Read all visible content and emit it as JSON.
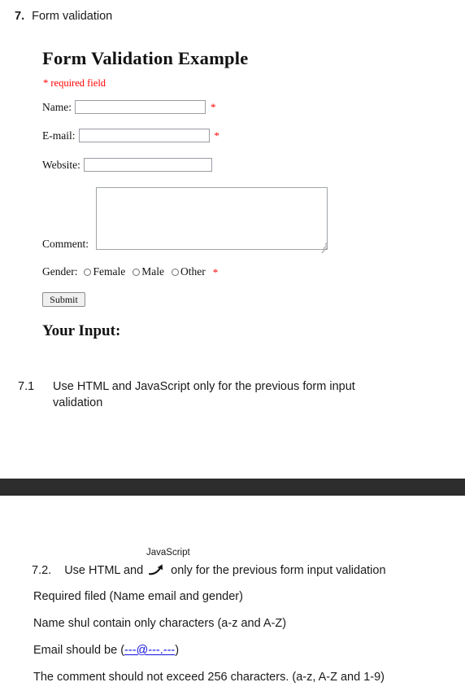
{
  "document": {
    "heading_number": "7.",
    "heading_text": "Form validation"
  },
  "form": {
    "title": "Form Validation Example",
    "required_note": "* required field",
    "fields": [
      {
        "label": "Name:",
        "value": "",
        "required_marker": "*"
      },
      {
        "label": "E-mail:",
        "value": "",
        "required_marker": "*"
      },
      {
        "label": "Website:",
        "value": "",
        "required_marker": ""
      }
    ],
    "comment": {
      "label": "Comment:",
      "value": ""
    },
    "gender": {
      "label": "Gender:",
      "options": [
        "Female",
        "Male",
        "Other"
      ],
      "selected": "",
      "required_marker": "*"
    },
    "submit_label": "Submit",
    "result_title": "Your Input:"
  },
  "items": {
    "item_71": {
      "number": "7.1",
      "text": "Use HTML and JavaScript only for the previous form input validation"
    },
    "item_72": {
      "number": "7.2.",
      "text_before": "Use HTML and",
      "text_after": "only for the previous form input validation",
      "callout_label": "JavaScript",
      "callout_icon": "arrow-up-right-icon"
    }
  },
  "requirements": [
    {
      "text": "Required filed (Name email and gender)"
    },
    {
      "text": "Name shul contain only characters (a-z and A-Z)"
    },
    {
      "text_before": "Email should be (",
      "link": "---@---.---",
      "text_after": ")"
    },
    {
      "text": "The comment should not exceed 256 characters. (a-z, A-Z and 1-9)"
    }
  ],
  "colors": {
    "required_red": "#ff0000",
    "link_blue": "#1010e0",
    "band_dark": "#2d2d2d"
  }
}
